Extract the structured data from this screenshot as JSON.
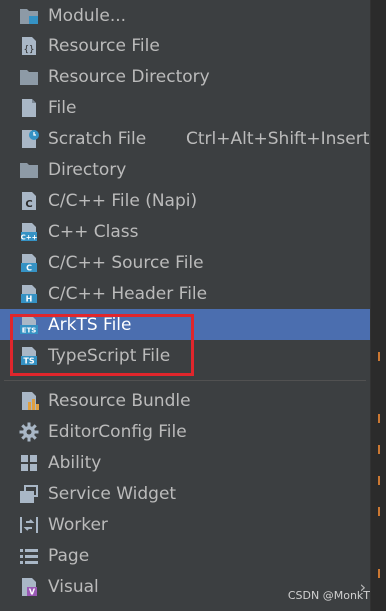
{
  "menu": {
    "items": [
      {
        "label": "Module...",
        "icon": "module-folder-icon"
      },
      {
        "label": "Resource File",
        "icon": "resource-file-icon"
      },
      {
        "label": "Resource Directory",
        "icon": "folder-icon"
      },
      {
        "label": "File",
        "icon": "file-icon"
      },
      {
        "label": "Scratch File",
        "icon": "scratch-file-icon",
        "shortcut": "Ctrl+Alt+Shift+Insert"
      },
      {
        "label": "Directory",
        "icon": "folder-icon"
      },
      {
        "label": "C/C++ File (Napi)",
        "icon": "c-file-icon",
        "icon_text": "C"
      },
      {
        "label": "C++ Class",
        "icon": "cpp-class-icon",
        "icon_text": "C++"
      },
      {
        "label": "C/C++ Source File",
        "icon": "c-source-icon",
        "icon_text": "C"
      },
      {
        "label": "C/C++ Header File",
        "icon": "c-header-icon",
        "icon_text": "H"
      },
      {
        "label": "ArkTS File",
        "icon": "ets-file-icon",
        "icon_text": "ETS",
        "selected": true
      },
      {
        "label": "TypeScript File",
        "icon": "ts-file-icon",
        "icon_text": "TS"
      },
      {
        "label": "Resource Bundle",
        "icon": "resource-bundle-icon"
      },
      {
        "label": "EditorConfig File",
        "icon": "gear-icon"
      },
      {
        "label": "Ability",
        "icon": "ability-grid-icon"
      },
      {
        "label": "Service Widget",
        "icon": "service-widget-icon"
      },
      {
        "label": "Worker",
        "icon": "worker-icon"
      },
      {
        "label": "Page",
        "icon": "page-list-icon"
      },
      {
        "label": "Visual",
        "icon": "visual-file-icon",
        "icon_text": "V",
        "submenu": true
      }
    ]
  },
  "colors": {
    "selection": "#4b6eaf",
    "text": "#bbbbbb",
    "highlight_border": "#e0262c",
    "menu_bg": "#3c3f41"
  },
  "watermark": "CSDN @MonkT"
}
